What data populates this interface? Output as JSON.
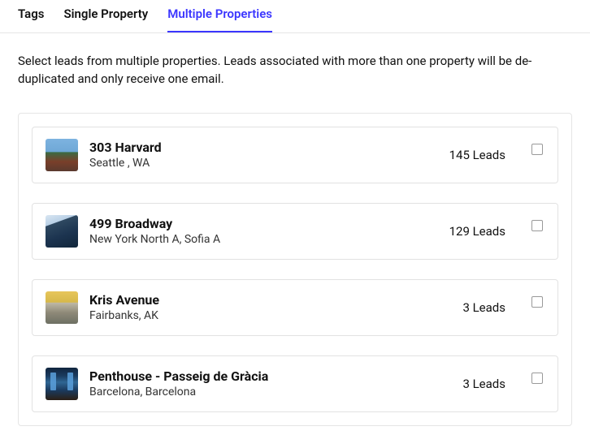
{
  "tabs": {
    "items": [
      {
        "label": "Tags",
        "active": false
      },
      {
        "label": "Single Property",
        "active": false
      },
      {
        "label": "Multiple Properties",
        "active": true
      }
    ]
  },
  "description": "Select leads from multiple properties. Leads associated with more than one property will be de-duplicated and only receive one email.",
  "properties": [
    {
      "name": "303 Harvard",
      "location": "Seattle , WA",
      "leads": "145 Leads",
      "checked": false
    },
    {
      "name": "499 Broadway",
      "location": "New York North A, Sofia A",
      "leads": "129 Leads",
      "checked": false
    },
    {
      "name": "Kris Avenue",
      "location": "Fairbanks, AK",
      "leads": "3 Leads",
      "checked": false
    },
    {
      "name": "Penthouse - Passeig de Gràcia",
      "location": "Barcelona, Barcelona",
      "leads": "3 Leads",
      "checked": false
    }
  ]
}
